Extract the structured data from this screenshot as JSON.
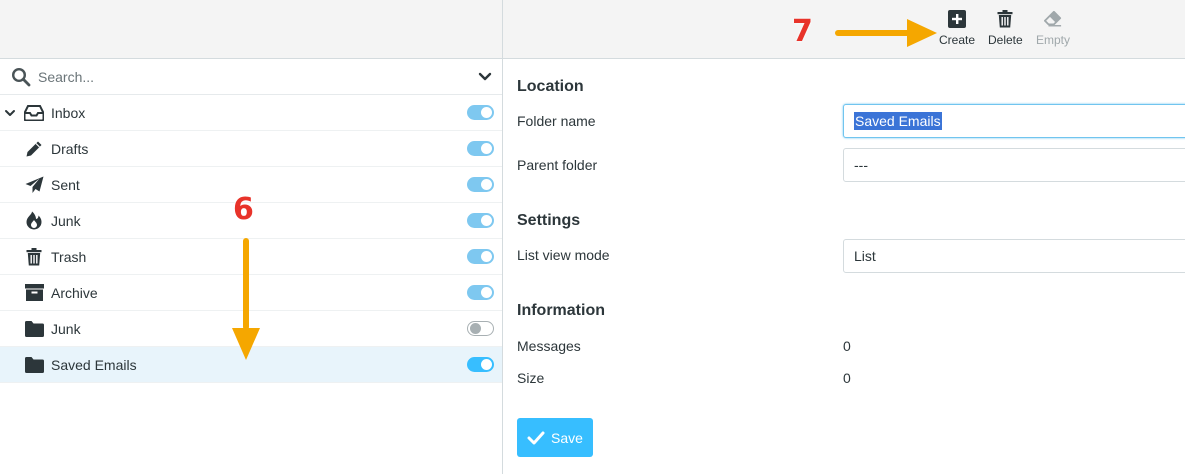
{
  "sidebar": {
    "search_placeholder": "Search...",
    "folders": [
      {
        "label": "Inbox",
        "icon": "inbox-icon",
        "subscribed": true
      },
      {
        "label": "Drafts",
        "icon": "pencil-icon",
        "subscribed": true
      },
      {
        "label": "Sent",
        "icon": "paper-plane-icon",
        "subscribed": true
      },
      {
        "label": "Junk",
        "icon": "fire-icon",
        "subscribed": true
      },
      {
        "label": "Trash",
        "icon": "trash-icon",
        "subscribed": true
      },
      {
        "label": "Archive",
        "icon": "archive-icon",
        "subscribed": true
      },
      {
        "label": "Junk",
        "icon": "folder-icon",
        "subscribed": false
      },
      {
        "label": "Saved Emails",
        "icon": "folder-icon",
        "subscribed": true,
        "selected": true
      }
    ]
  },
  "toolbar": {
    "create_label": "Create",
    "delete_label": "Delete",
    "empty_label": "Empty"
  },
  "form": {
    "location_title": "Location",
    "folder_name_label": "Folder name",
    "folder_name_value": "Saved Emails",
    "parent_folder_label": "Parent folder",
    "parent_folder_value": "---",
    "settings_title": "Settings",
    "list_view_mode_label": "List view mode",
    "list_view_mode_value": "List",
    "information_title": "Information",
    "messages_label": "Messages",
    "messages_value": "0",
    "size_label": "Size",
    "size_value": "0",
    "save_label": "Save"
  },
  "annotations": {
    "step6": "6",
    "step7": "7"
  },
  "colors": {
    "accent": "#37beff",
    "toggle_on": "#7ec8f0",
    "arrow": "#f5a700",
    "annotation_number": "#e8332a"
  }
}
